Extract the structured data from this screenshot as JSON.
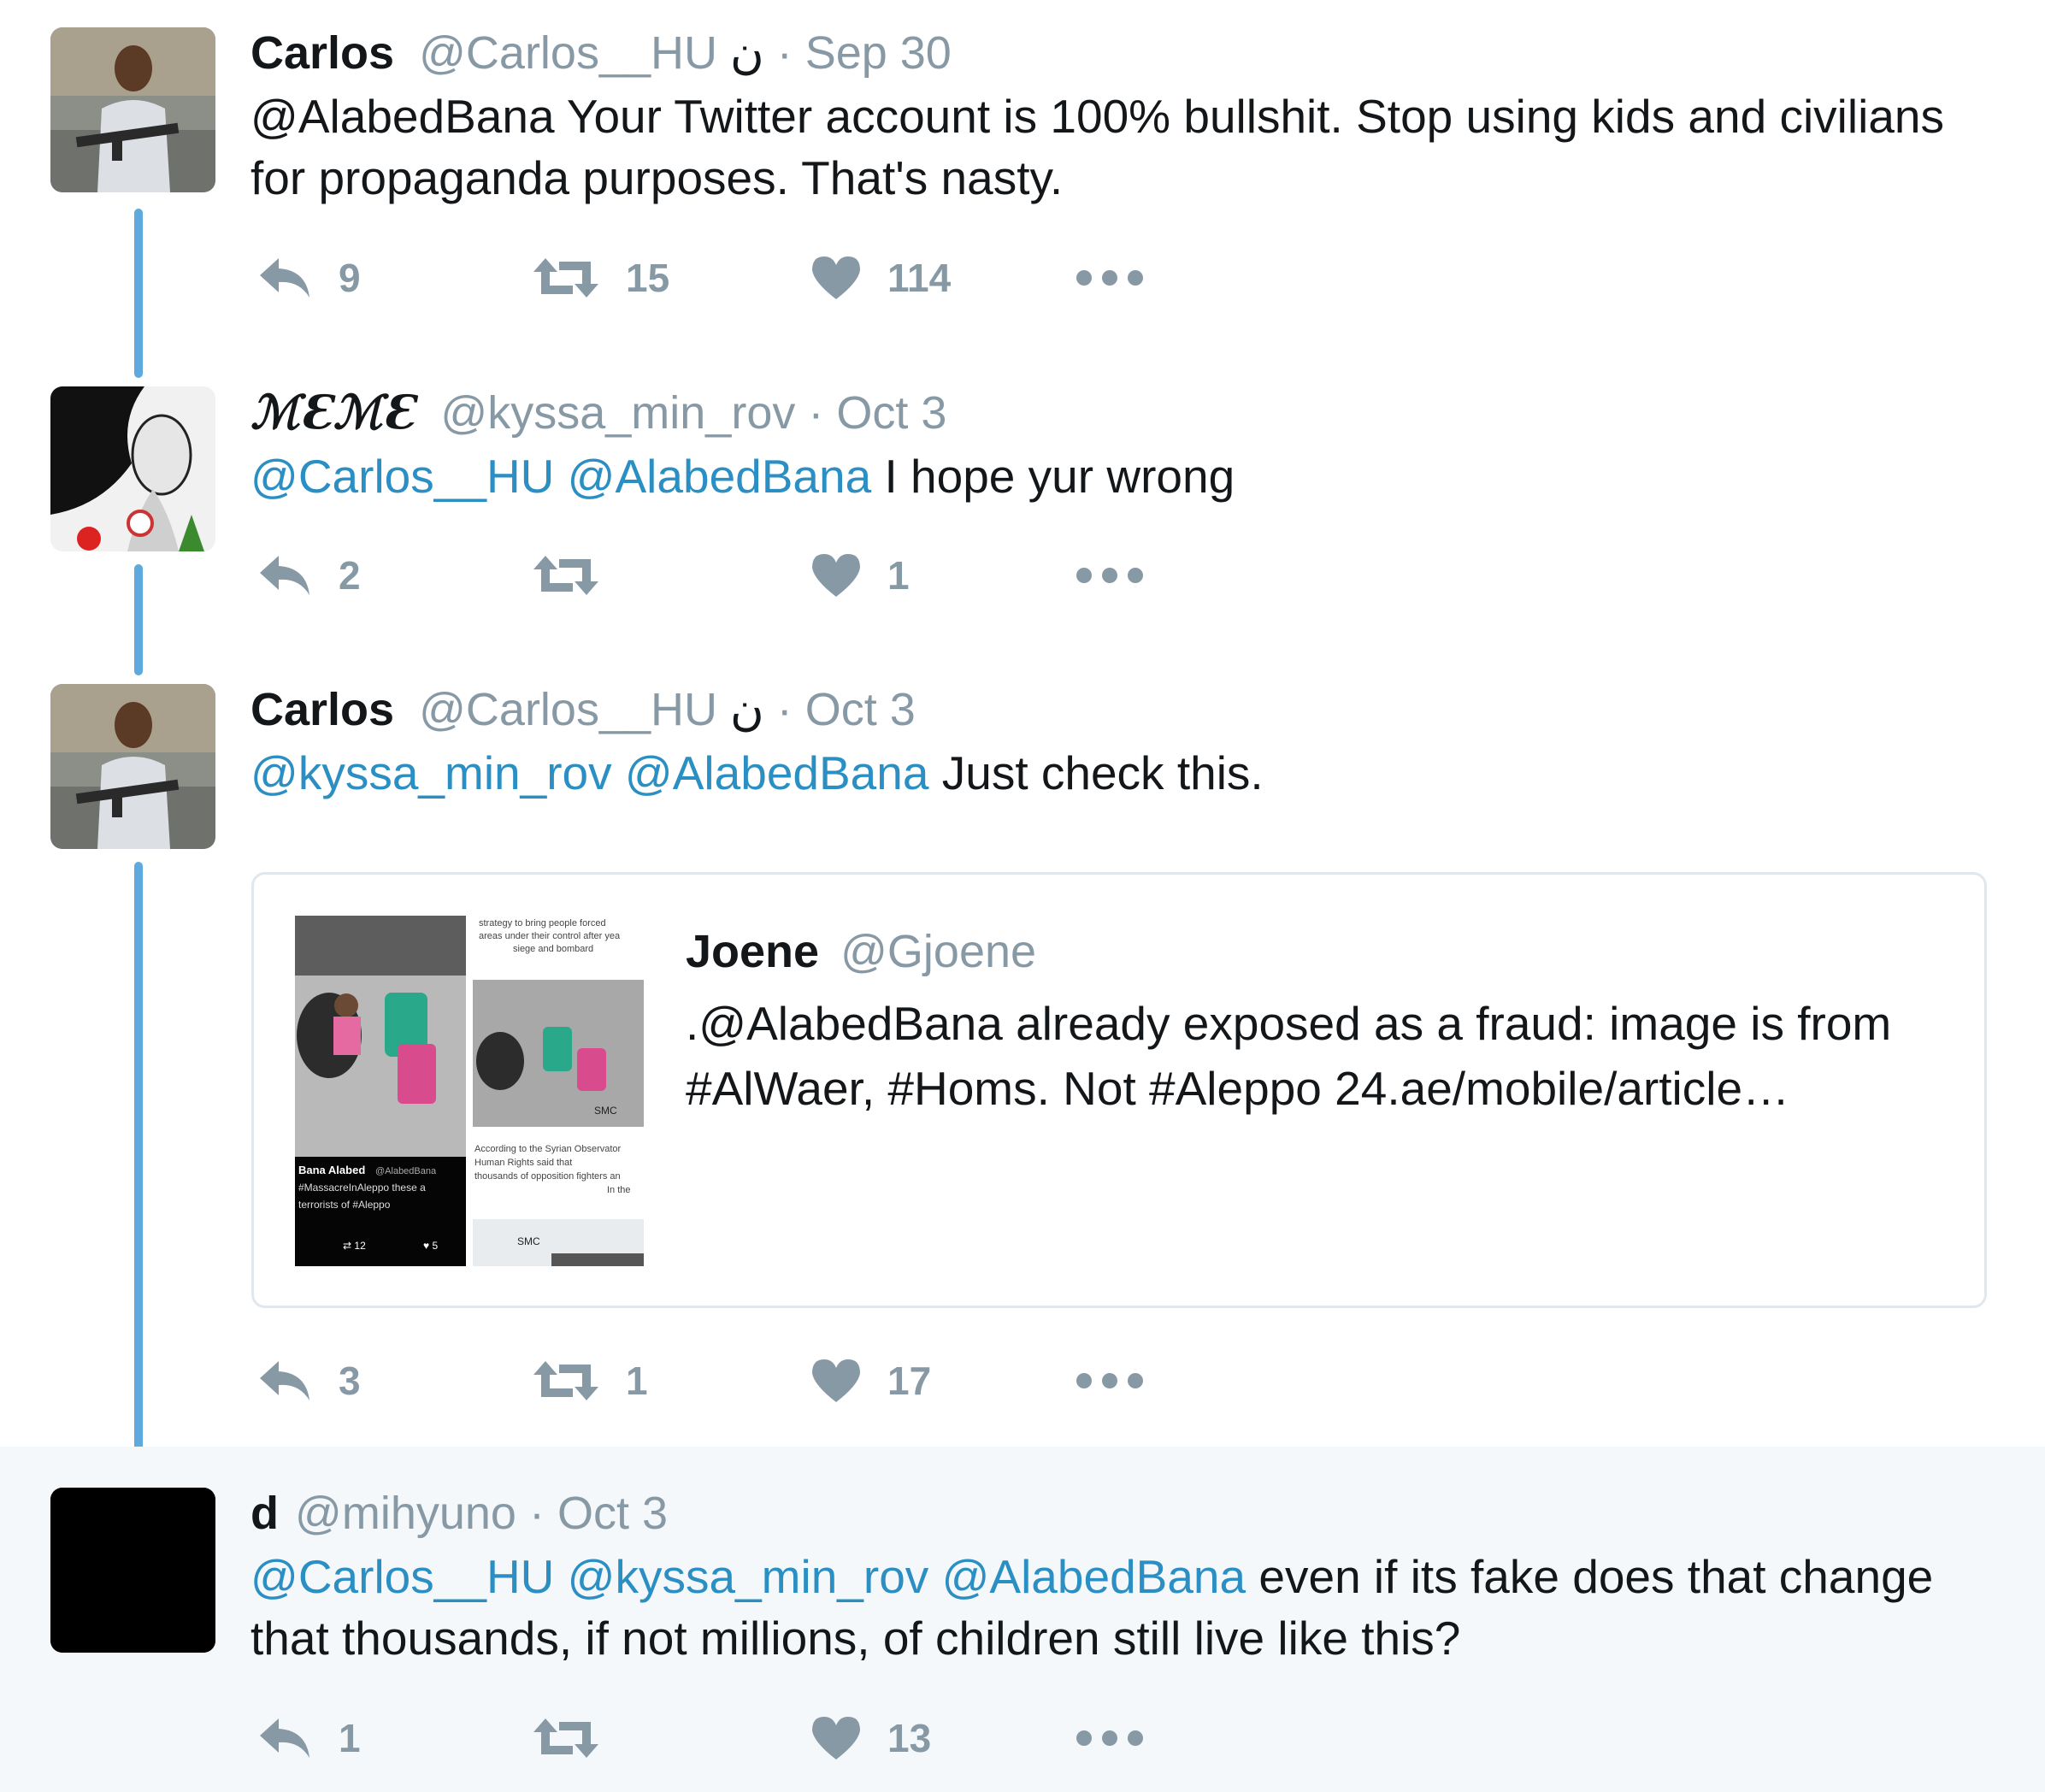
{
  "colors": {
    "thread_line": "#5ea9dd",
    "mention": "#2b8fc4",
    "meta_gray": "#8899a6",
    "highlight_bg": "#f5f8fa"
  },
  "tweets": [
    {
      "name": "Carlos",
      "handle": "@Carlos__HU",
      "flag": "ن",
      "date": "· Sep 30",
      "text_mentions": "",
      "text": "@AlabedBana Your Twitter account is 100% bullshit. Stop using kids and civilians for propaganda purposes. That's nasty.",
      "replies": "9",
      "retweets": "15",
      "likes": "114"
    },
    {
      "name": "ℳƐℳƐ",
      "handle": "@kyssa_min_rov",
      "date": "· Oct 3",
      "text_mentions": "@Carlos__HU @AlabedBana",
      "text": "I hope yur wrong",
      "replies": "2",
      "retweets": "",
      "likes": "1"
    },
    {
      "name": "Carlos",
      "handle": "@Carlos__HU",
      "flag": "ن",
      "date": "· Oct 3",
      "text_mentions": "@kyssa_min_rov @AlabedBana",
      "text": "Just check this.",
      "replies": "3",
      "retweets": "1",
      "likes": "17",
      "quote": {
        "name": "Joene",
        "handle": "@Gjoene",
        "text": ".@AlabedBana already exposed as a fraud: image is from #AlWaer, #Homs. Not #Aleppo 24.ae/mobile/article…",
        "media_caption_name": "Bana Alabed",
        "media_caption_handle": "@AlabedBana",
        "media_caption_text": "#MassacreInAleppo these a terrorists of #Aleppo",
        "media_rt_count": "12",
        "media_like_count": "5",
        "media_right_top_text": "strategy to bring people forced areas under their control after yea siege and bombard",
        "media_right_mid_text": "According to the Syrian Observator Human Rights said that thousands of opposition fighters an In the",
        "media_logo": "SMC"
      }
    },
    {
      "name": "d",
      "handle": "@mihyuno",
      "date": "· Oct 3",
      "text_mentions": "@Carlos__HU @kyssa_min_rov @AlabedBana",
      "text": "even if its fake does that change that thousands, if not millions, of children still live like this?",
      "replies": "1",
      "retweets": "",
      "likes": "13"
    }
  ],
  "icons": {
    "reply": "reply-icon",
    "retweet": "retweet-icon",
    "like": "heart-icon",
    "more": "more-dots-icon"
  }
}
